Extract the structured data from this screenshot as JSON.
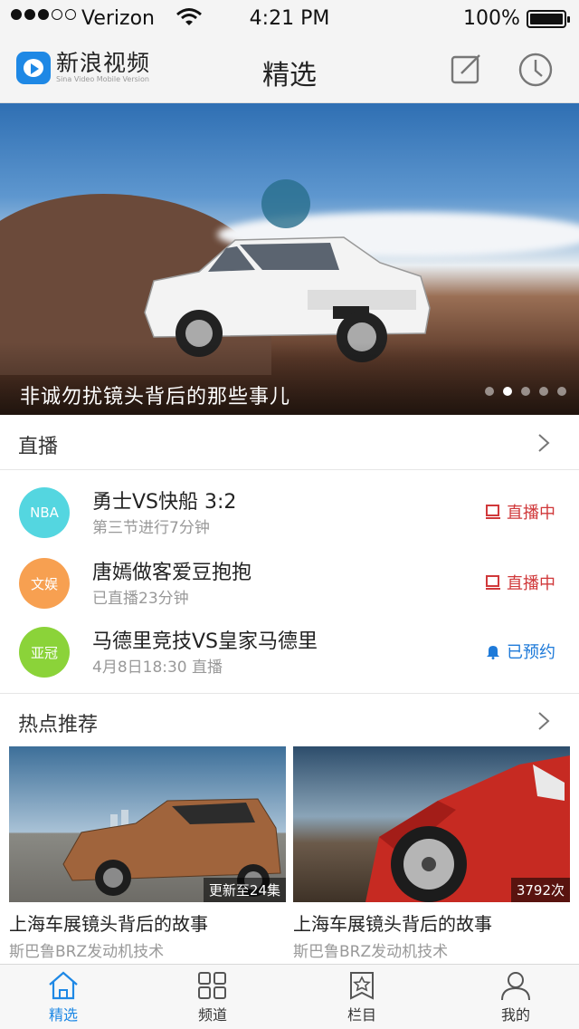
{
  "status_bar": {
    "carrier": "Verizon",
    "time": "4:21 PM",
    "battery": "100%",
    "battery_level": 1.0,
    "signal_bars_filled": 3,
    "signal_bars_total": 5
  },
  "header": {
    "logo_text": "新浪视频",
    "logo_subtitle": "Sina Video Mobile Version",
    "title": "精选",
    "edit_icon": "edit-icon",
    "history_icon": "clock-icon"
  },
  "banner": {
    "caption": "非诚勿扰镜头背后的那些事儿",
    "dots_total": 5,
    "dots_active": 1
  },
  "live": {
    "section_title": "直播",
    "items": [
      {
        "avatar": "NBA",
        "avatar_color": "#54d6e0",
        "title": "勇士VS快船  3:2",
        "sub": "第三节进行7分钟",
        "status": "直播中",
        "status_type": "live"
      },
      {
        "avatar": "文娱",
        "avatar_color": "#f7a051",
        "title": "唐嫣做客爱豆抱抱",
        "sub": "已直播23分钟",
        "status": "直播中",
        "status_type": "live"
      },
      {
        "avatar": "亚冠",
        "avatar_color": "#8bd339",
        "title": "马德里竞技VS皇家马德里",
        "sub": "4月8日18:30 直播",
        "status": "已预约",
        "status_type": "booked"
      }
    ]
  },
  "hot": {
    "section_title": "热点推荐",
    "cards": [
      {
        "badge": "更新至24集",
        "title": "上海车展镜头背后的故事",
        "sub": "斯巴鲁BRZ发动机技术"
      },
      {
        "badge": "3792次",
        "title": "上海车展镜头背后的故事",
        "sub": "斯巴鲁BRZ发动机技术"
      }
    ]
  },
  "tabbar": {
    "items": [
      {
        "label": "精选",
        "icon": "home-icon",
        "active": true
      },
      {
        "label": "频道",
        "icon": "grid-icon",
        "active": false
      },
      {
        "label": "栏目",
        "icon": "bookmark-star-icon",
        "active": false
      },
      {
        "label": "我的",
        "icon": "user-icon",
        "active": false
      }
    ]
  },
  "colors": {
    "accent": "#1e88e5",
    "live_red": "#d0383a",
    "booked_blue": "#1e7ad9"
  }
}
